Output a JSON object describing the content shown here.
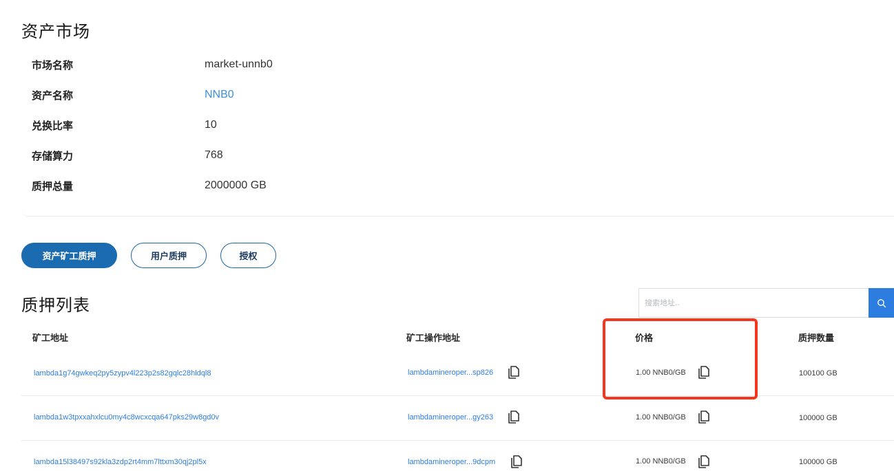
{
  "market_section": {
    "title": "资产市场",
    "fields": [
      {
        "label": "市场名称",
        "value": "market-unnb0"
      },
      {
        "label": "资产名称",
        "value": "NNB0"
      },
      {
        "label": "兑换比率",
        "value": "10"
      },
      {
        "label": "存储算力",
        "value": "768"
      },
      {
        "label": "质押总量",
        "value": "2000000 GB"
      }
    ]
  },
  "tabs": {
    "asset_miner_pledge": "资产矿工质押",
    "user_pledge": "用户质押",
    "authorize": "授权"
  },
  "pledge_list": {
    "title": "质押列表",
    "search_placeholder": "搜索地址..",
    "columns": {
      "miner_address": "矿工地址",
      "miner_operator_address": "矿工操作地址",
      "price": "价格",
      "pledge_amount": "质押数量"
    },
    "rows": [
      {
        "miner_address": "lambda1g74gwkeq2py5zypv4l223p2s82gqlc28hldql8",
        "operator_address": "lambdamineroper...sp826",
        "price": "1.00 NNB0/GB",
        "amount": "100100 GB"
      },
      {
        "miner_address": "lambda1w3tpxxahxlcu0my4c8wcxcqa647pks29w8gd0v",
        "operator_address": "lambdamineroper...gy263",
        "price": "1.00 NNB0/GB",
        "amount": "100000 GB"
      },
      {
        "miner_address": "lambda15l38497s92kla3zdp2rt4mm7lttxm30qj2pl5x",
        "operator_address": "lambdamineroper...9dcpm",
        "price": "1.00 NNB0/GB",
        "amount": "100000 GB"
      }
    ]
  },
  "colors": {
    "primary": "#1a6bb0",
    "link": "#2d7de0",
    "highlight": "#f5361c"
  },
  "icons": {
    "copy": "copy-icon",
    "search": "search-icon"
  }
}
